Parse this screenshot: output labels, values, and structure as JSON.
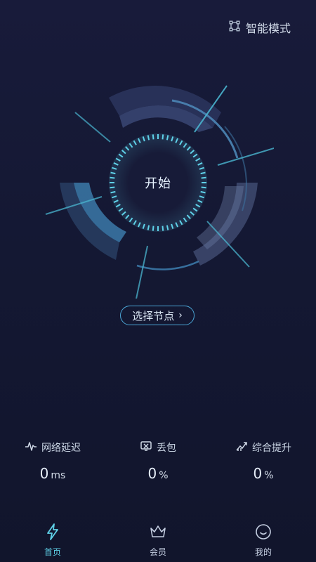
{
  "header": {
    "mode_label": "智能模式",
    "mode_icon": "grid-square-icon"
  },
  "gauge": {
    "start_label": "开始"
  },
  "node_select": {
    "label": "选择节点",
    "chevron": "›"
  },
  "stats": [
    {
      "label": "网络延迟",
      "icon": "pulse-icon",
      "value": "0",
      "unit": "ms"
    },
    {
      "label": "丢包",
      "icon": "packet-loss-icon",
      "value": "0",
      "unit": "%"
    },
    {
      "label": "综合提升",
      "icon": "trend-up-icon",
      "value": "0",
      "unit": "%"
    }
  ],
  "tabbar": {
    "items": [
      {
        "label": "首页",
        "icon": "lightning-icon",
        "active": true
      },
      {
        "label": "会员",
        "icon": "crown-icon",
        "active": false
      },
      {
        "label": "我的",
        "icon": "smile-icon",
        "active": false
      }
    ]
  },
  "colors": {
    "background": "#141833",
    "accent": "#5fd1e8",
    "ring": "#3d7fb0"
  }
}
